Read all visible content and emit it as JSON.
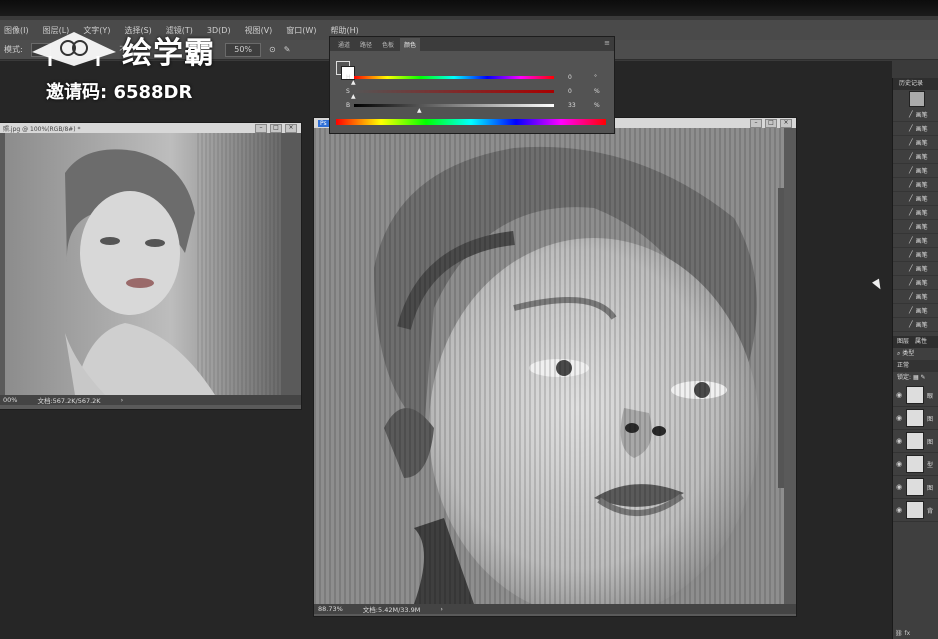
{
  "menu": {
    "items": [
      "图像(I)",
      "图层(L)",
      "文字(Y)",
      "选择(S)",
      "滤镜(T)",
      "3D(D)",
      "视图(V)",
      "窗口(W)",
      "帮助(H)"
    ]
  },
  "options_bar": {
    "mode_label": "模式:",
    "opacity_label": "不",
    "flow_value": "50%"
  },
  "watermark": {
    "brand": "绘学霸",
    "invite": "邀请码: 6588DR"
  },
  "doc_left": {
    "title": "照.jpg @ 100%(RGB/8#) *",
    "zoom": "00%",
    "doc_info": "文档:567.2K/567.2K"
  },
  "doc_main": {
    "title_icon": "Ps",
    "zoom": "88.73%",
    "doc_info": "文档:5.42M/33.9M"
  },
  "color_panel": {
    "tabs": [
      "通道",
      "路径",
      "色板",
      "颜色"
    ],
    "active_tab": "颜色",
    "sliders": [
      {
        "label": "H",
        "value": "0",
        "unit": "°",
        "fraction": 0.0
      },
      {
        "label": "S",
        "value": "0",
        "unit": "%",
        "fraction": 0.0
      },
      {
        "label": "B",
        "value": "33",
        "unit": "%",
        "fraction": 0.33
      }
    ]
  },
  "history_panel": {
    "title": "历史记录",
    "items": [
      "画笔",
      "画笔",
      "画笔",
      "画笔",
      "画笔",
      "画笔",
      "画笔",
      "画笔",
      "画笔",
      "画笔",
      "画笔",
      "画笔",
      "画笔",
      "画笔",
      "画笔",
      "画笔"
    ]
  },
  "layers_panel": {
    "tabs": [
      "图层",
      "属性"
    ],
    "filter_label": "类型",
    "blend_mode": "正常",
    "lock_label": "锁定:",
    "layers": [
      "眼",
      "图",
      "图",
      "型",
      "图",
      "背"
    ]
  },
  "colors": {
    "accent": "#2f6fd6",
    "panel_bg": "#535353",
    "workspace": "#262626"
  }
}
